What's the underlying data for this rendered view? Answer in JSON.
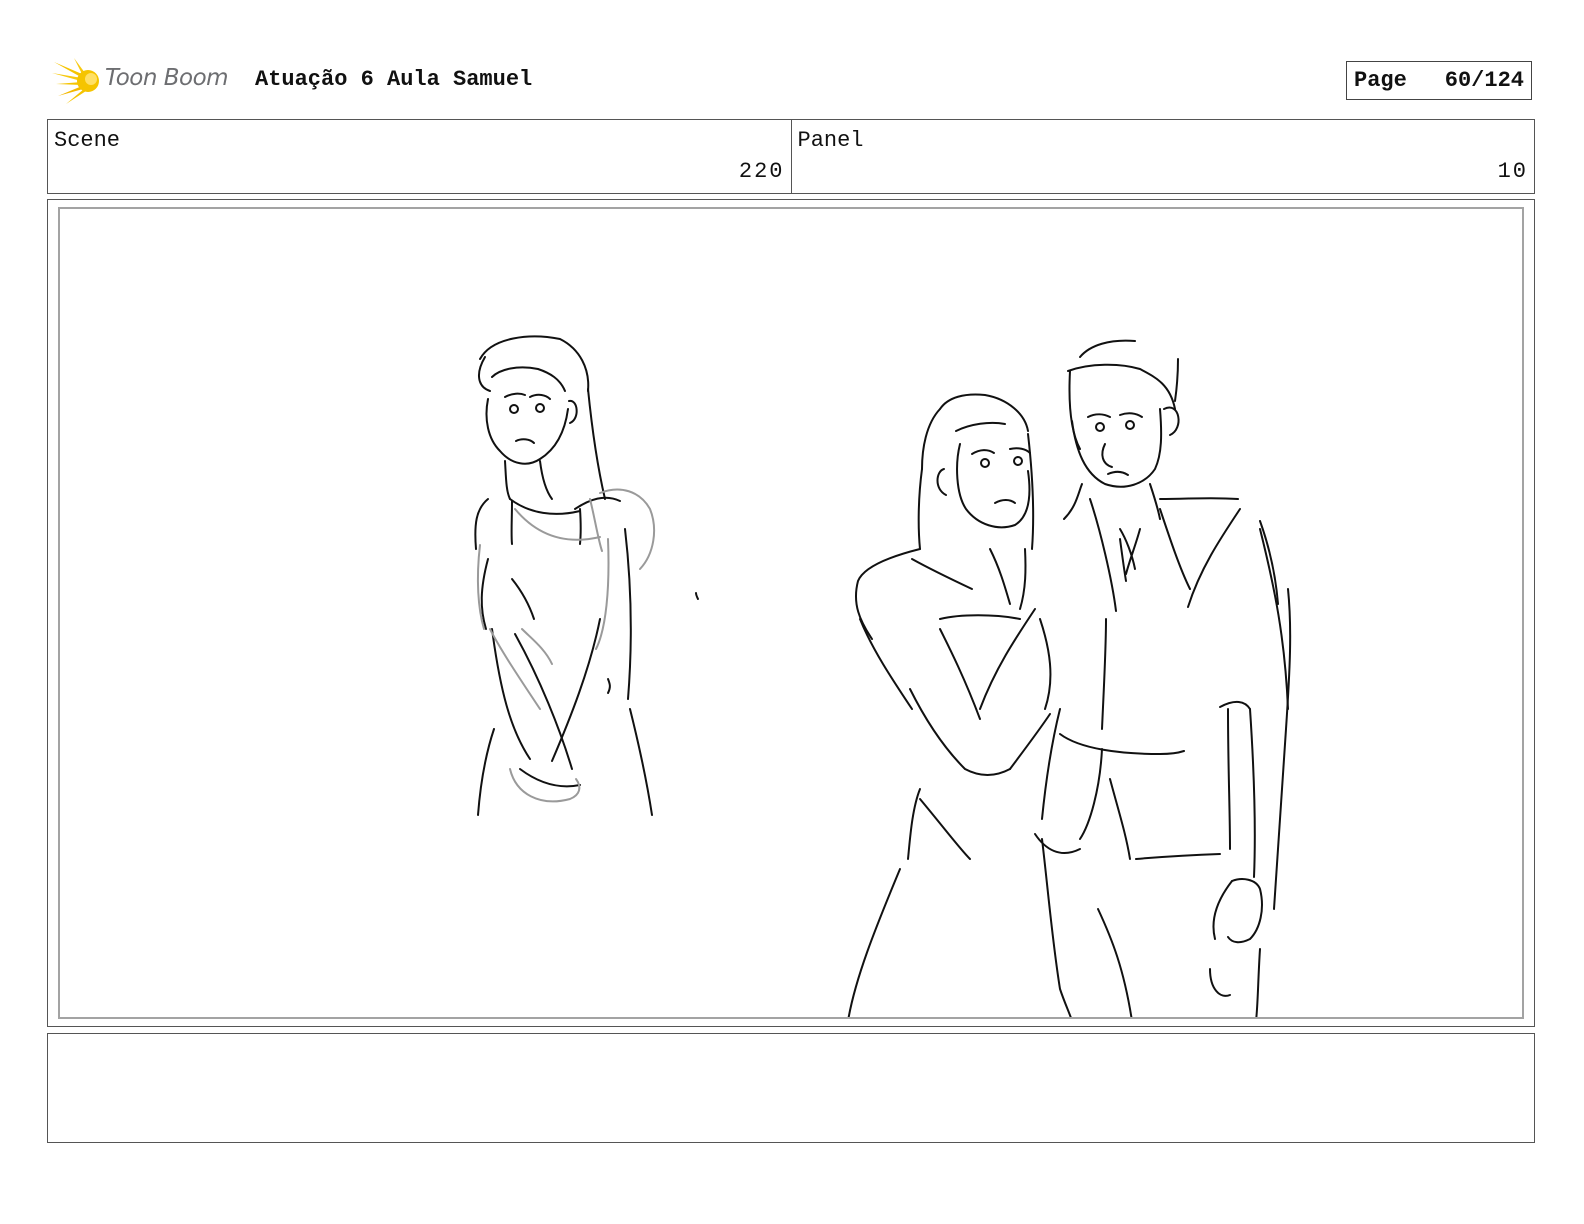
{
  "header": {
    "logo_text": "Toon Boom",
    "title": "Atuação 6 Aula Samuel",
    "page_label": "Page",
    "page_value": "60/124"
  },
  "info": {
    "scene_label": "Scene",
    "scene_value": "220",
    "panel_label": "Panel",
    "panel_value": "10"
  },
  "icons": {
    "logo": "starburst-logo-icon"
  },
  "colors": {
    "logo_yellow": "#f5c400",
    "logo_text": "#6d6e71",
    "sketch_line": "#111111",
    "sketch_rough": "#9a9a9a"
  },
  "notes": ""
}
